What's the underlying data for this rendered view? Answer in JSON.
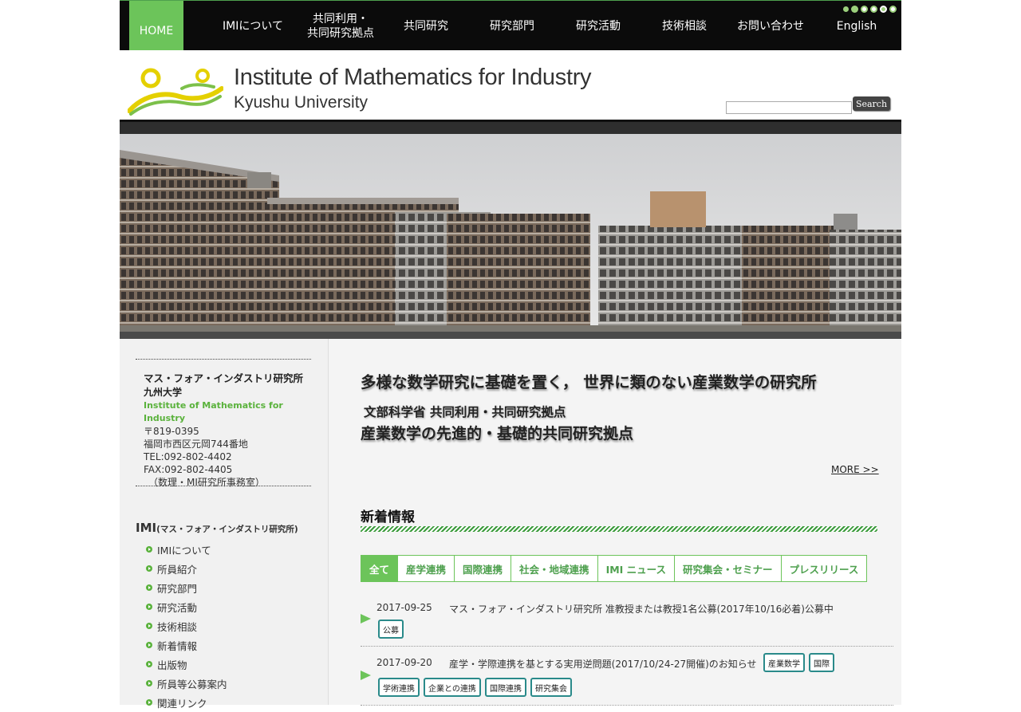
{
  "nav": {
    "items": [
      {
        "label": "HOME",
        "active": true
      },
      {
        "label": "IMIについて"
      },
      {
        "label": "共同利用・\n共同研究拠点"
      },
      {
        "label": "共同研究"
      },
      {
        "label": "研究部門"
      },
      {
        "label": "研究活動"
      },
      {
        "label": "技術相談"
      },
      {
        "label": "お問い合わせ"
      },
      {
        "label": "English"
      }
    ],
    "dots_colors": [
      "#9bd07c",
      "#9bd07c",
      "#ffffff",
      "#ffffff",
      "#9bd07c",
      "#ffffff"
    ]
  },
  "header": {
    "title_main": "Institute of Mathematics for Industry",
    "title_sub": "Kyushu University",
    "search_placeholder": "",
    "search_button": "Search",
    "logo_icon": "imi-logo-icon"
  },
  "sidebar": {
    "address": {
      "name": "マス・フォア・インダストリ研究所",
      "univ": "九州大学",
      "name_en": "Institute of Mathematics for Industry",
      "postal": "〒819-0395",
      "street": "福岡市西区元岡744番地",
      "tel": "TEL:092-802-4402",
      "fax": "FAX:092-802-4405",
      "note": "（数理・MI研究所事務室）"
    },
    "section_title": "IMI",
    "section_title_small": "(マス・フォア・インダストリ研究所)",
    "menu": [
      "IMIについて",
      "所員紹介",
      "研究部門",
      "研究活動",
      "技術相談",
      "新着情報",
      "出版物",
      "所員等公募案内",
      "関連リンク"
    ]
  },
  "main": {
    "catch1": "多様な数学研究に基礎を置く， 世界に類のない産業数学の研究所",
    "catch2": "文部科学省 共同利用・共同研究拠点",
    "catch3": "産業数学の先進的・基礎的共同研究拠点",
    "more": "MORE >>",
    "news_title": "新着情報",
    "tabs": [
      "全て",
      "産学連携",
      "国際連携",
      "社会・地域連携",
      "IMI ニュース",
      "研究集会・セミナー",
      "プレスリリース"
    ],
    "news": [
      {
        "date": "2017-09-25",
        "text": "マス・フォア・インダストリ研究所 准教授または教授1名公募(2017年10/16必着)公募中",
        "tags": [
          "公募"
        ]
      },
      {
        "date": "2017-09-20",
        "text": "産学・学際連携を基とする実用逆問題(2017/10/24-27開催)のお知らせ",
        "tags": [
          "産業数学",
          "国際",
          "学術連携",
          "企業との連携",
          "国際連携",
          "研究集会"
        ]
      }
    ]
  },
  "colors": {
    "accent_green": "#6cc45a",
    "nav_bg": "#0b0b0b",
    "tag_border": "#2a8a8a"
  }
}
